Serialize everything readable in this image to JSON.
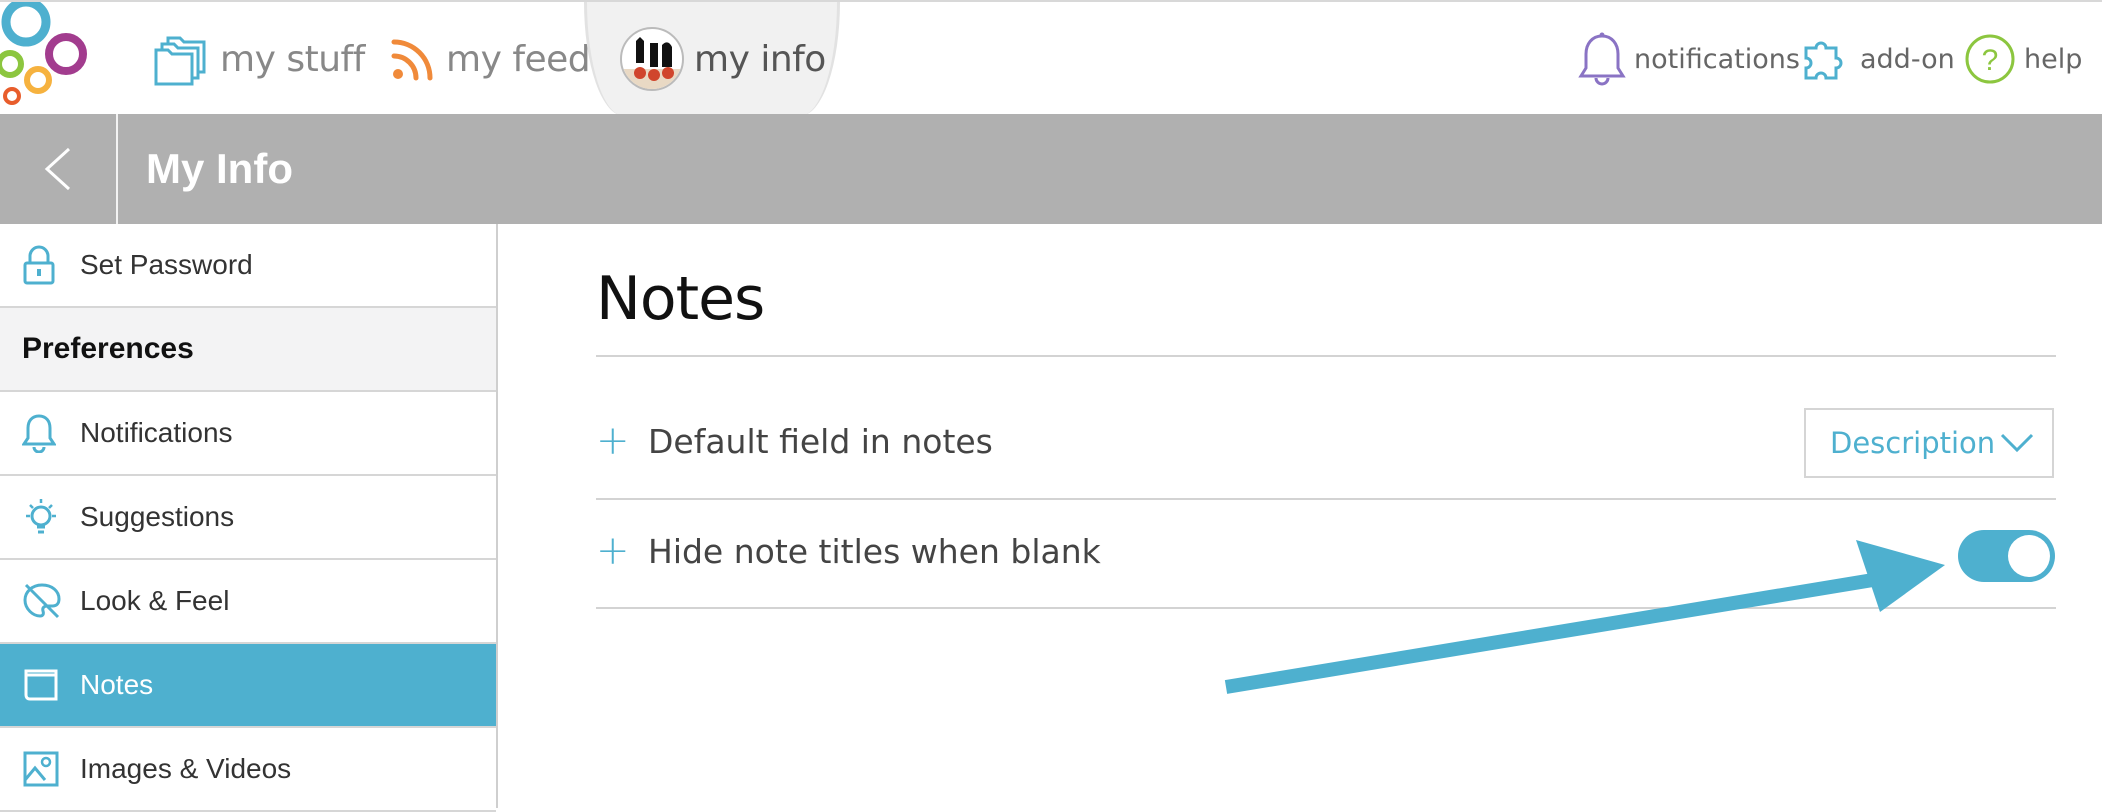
{
  "nav": {
    "my_stuff": "my stuff",
    "my_feed": "my feed",
    "my_info": "my info",
    "notifications": "notifications",
    "addon": "add-on",
    "help": "help"
  },
  "header": {
    "title": "My Info"
  },
  "sidebar": {
    "items": [
      {
        "label": "Set Password",
        "icon": "lock-icon"
      },
      {
        "label": "Preferences",
        "section": true
      },
      {
        "label": "Notifications",
        "icon": "bell-icon"
      },
      {
        "label": "Suggestions",
        "icon": "lightbulb-icon"
      },
      {
        "label": "Look & Feel",
        "icon": "palette-icon"
      },
      {
        "label": "Notes",
        "icon": "notes-icon",
        "active": true
      },
      {
        "label": "Images & Videos",
        "icon": "image-icon"
      }
    ]
  },
  "content": {
    "title": "Notes",
    "settings": [
      {
        "label": "Default field in notes",
        "control": "dropdown",
        "value": "Description"
      },
      {
        "label": "Hide note titles when blank",
        "control": "toggle",
        "on": true
      }
    ]
  },
  "colors": {
    "accent": "#4eb0cf",
    "header_bg": "#b0b0b0",
    "sidebar_section_bg": "#f3f3f4"
  }
}
